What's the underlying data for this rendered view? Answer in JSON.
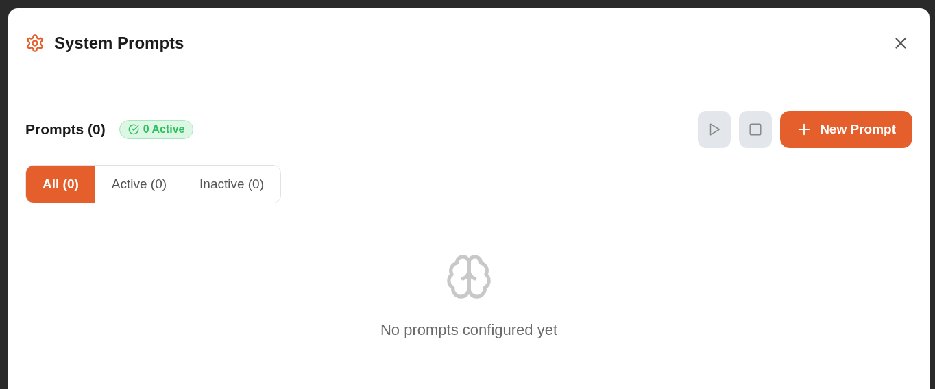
{
  "dialog": {
    "title": "System Prompts"
  },
  "header": {
    "title": "Prompts (0)",
    "badge": "0 Active"
  },
  "actions": [
    {
      "kind": "play",
      "disabled": true
    },
    {
      "kind": "stop",
      "disabled": true
    },
    {
      "kind": "new",
      "label": "New Prompt",
      "disabled": false
    }
  ],
  "tabs": [
    {
      "label": "All (0)",
      "selected": true
    },
    {
      "label": "Active (0)",
      "selected": false
    },
    {
      "label": "Inactive (0)",
      "selected": false
    }
  ],
  "empty_state": {
    "message": "No prompts configured yet"
  }
}
